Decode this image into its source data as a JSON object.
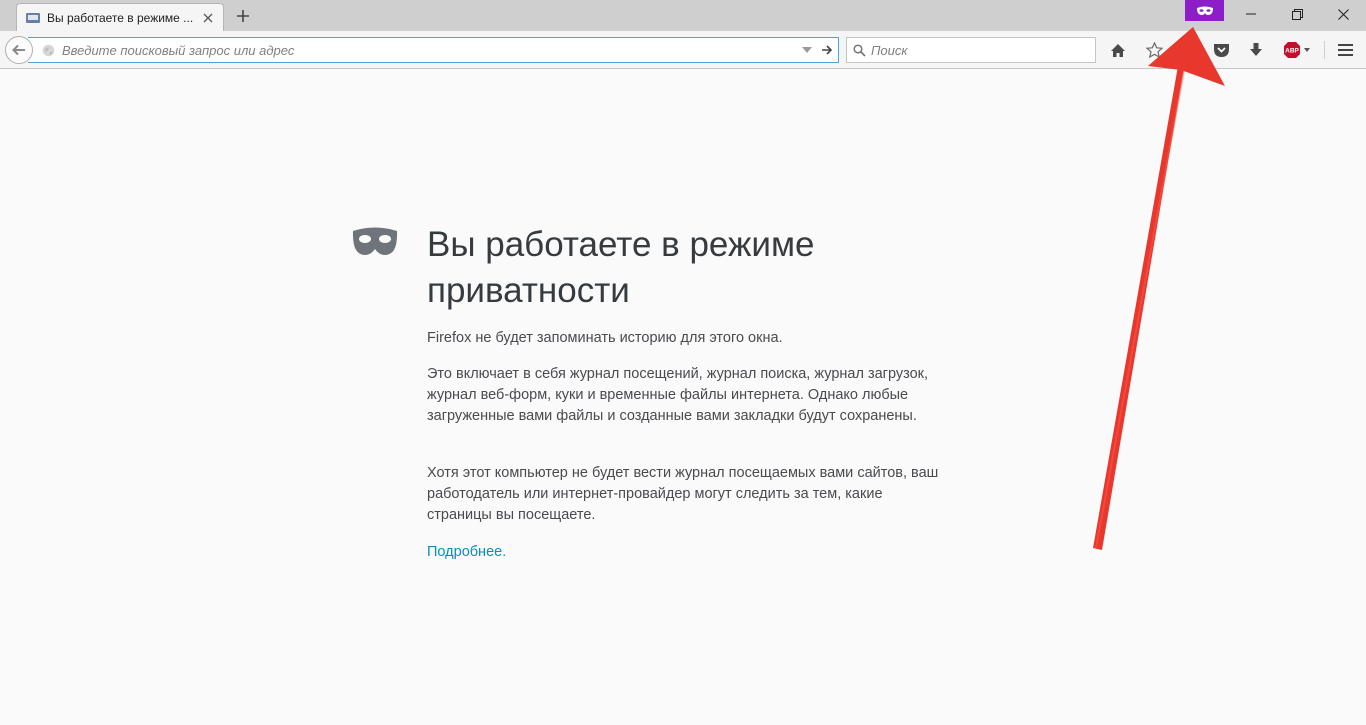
{
  "window": {
    "tab_title": "Вы работаете в режиме ..."
  },
  "toolbar": {
    "url_placeholder": "Введите поисковый запрос или адрес",
    "search_placeholder": "Поиск",
    "adblock_label": "ABP"
  },
  "content": {
    "title": "Вы работаете в режиме приватности",
    "paragraphs": [
      "Firefox не будет запоминать историю для этого окна.",
      "Это включает в себя журнал посещений, журнал поиска, журнал загрузок, журнал веб-форм, куки и временные файлы интернета. Однако любые загруженные вами файлы и созданные вами закладки будут сохранены.",
      "Хотя этот компьютер не будет вести журнал посещаемых вами сайтов, ваш работодатель или интернет-провайдер могут следить за тем, какие страницы вы посещаете."
    ],
    "learn_more": "Подробнее."
  },
  "icons": {
    "tab_favicon": "private-mask-icon",
    "private_badge": "private-mask-icon",
    "page_mask": "private-mask-icon",
    "back": "back-arrow-icon",
    "globe": "globe-icon",
    "dropmarker": "chevron-down-icon",
    "go": "go-arrow-icon",
    "search": "search-icon",
    "home": "home-icon",
    "bookmark": "star-icon",
    "pocket": "pocket-icon",
    "downloads": "download-icon",
    "menu": "hamburger-icon"
  },
  "colors": {
    "private_purple": "#8c1ec9",
    "link": "#0a8dbd",
    "urlbar_focus": "#4fa3dc",
    "annotation_arrow": "#e8372d",
    "abp_red": "#c70d2c"
  }
}
